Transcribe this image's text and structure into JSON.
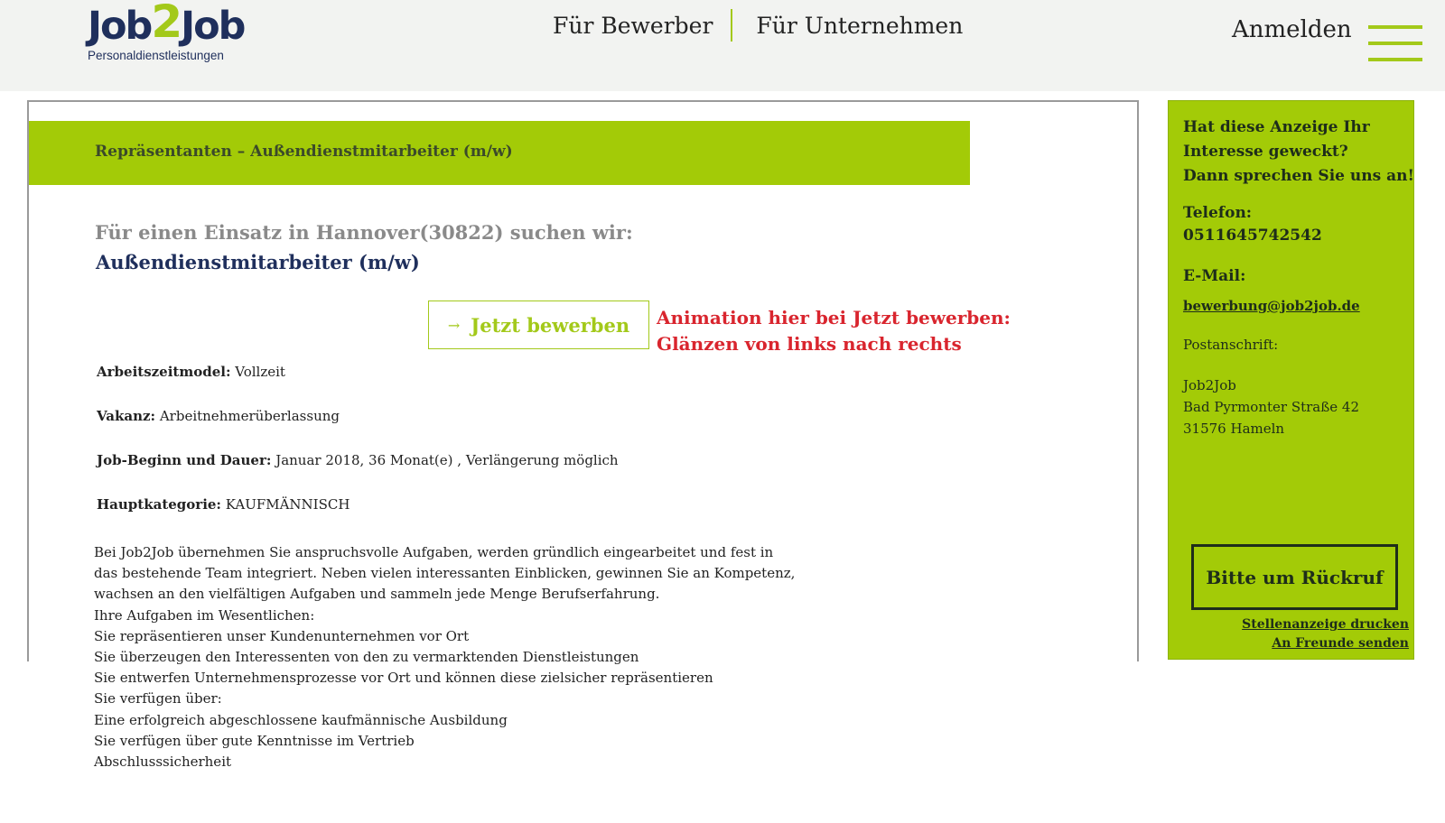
{
  "header": {
    "logo_main_a": "Job",
    "logo_main_two": "2",
    "logo_main_b": "Job",
    "logo_sub": "Personaldienstleistungen",
    "nav": [
      "Für Bewerber",
      "Für Unternehmen"
    ],
    "login": "Anmelden",
    "accent": "#a3c91a"
  },
  "job": {
    "title_bar": "Repräsentanten – Außendienstmitarbeiter (m/w)",
    "intro": "Für einen Einsatz in Hannover(30822) suchen wir:",
    "position": "Außendienstmitarbeiter (m/w)",
    "apply_label": "Jetzt bewerben",
    "note_line1": "Animation hier bei Jetzt bewerben:",
    "note_line2": "Glänzen von links nach rechts",
    "details": [
      {
        "label": "Arbeitszeitmodel:",
        "value": "Vollzeit"
      },
      {
        "label": "Vakanz:",
        "value": "Arbeitnehmerüberlassung"
      },
      {
        "label": "Job-Beginn und Dauer:",
        "value": "Januar 2018, 36 Monat(e) , Verlängerung möglich"
      },
      {
        "label": "Hauptkategorie:",
        "value": "KAUFMÄNNISCH"
      }
    ],
    "body_lines": [
      "Bei Job2Job übernehmen Sie anspruchsvolle Aufgaben, werden gründlich eingearbeitet und fest in",
      "das bestehende Team integriert. Neben vielen interessanten Einblicken, gewinnen Sie an Kompetenz,",
      "wachsen an den vielfältigen Aufgaben und sammeln jede Menge Berufserfahrung.",
      "Ihre Aufgaben im Wesentlichen:",
      "Sie repräsentieren unser Kundenunternehmen vor Ort",
      "Sie überzeugen den Interessenten von den zu vermarktenden Dienstleistungen",
      "Sie entwerfen Unternehmensprozesse vor Ort und können diese zielsicher repräsentieren",
      "Sie verfügen über:",
      "Eine erfolgreich abgeschlossene kaufmännische Ausbildung",
      "Sie verfügen über gute Kenntnisse im Vertrieb",
      "Abschlusssicherheit"
    ]
  },
  "sidebar": {
    "head_lines": [
      "Hat diese Anzeige Ihr",
      "Interesse geweckt?",
      "Dann sprechen Sie uns an!"
    ],
    "phone_label": "Telefon:",
    "phone": "0511645742542",
    "mail_label": "E-Mail:",
    "mail": "bewerbung@job2job.de",
    "post_label": "Postanschrift:",
    "address": [
      "Job2Job",
      "Bad Pyrmonter Straße 42",
      "31576 Hameln"
    ],
    "callback": "Bitte um Rückruf",
    "print": "Stellenanzeige drucken",
    "send": "An Freunde senden",
    "bg": "#a3cb07"
  }
}
